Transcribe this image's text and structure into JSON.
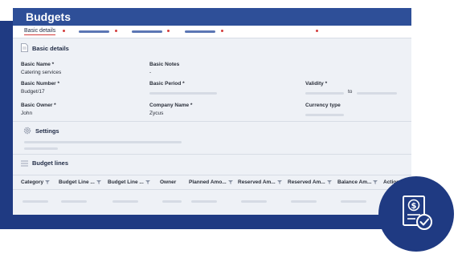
{
  "window": {
    "title": "Budgets"
  },
  "tabs": {
    "active_label": "Basic details"
  },
  "basic_details": {
    "section_title": "Basic details",
    "basic_name_label": "Basic Name *",
    "basic_name_value": "Catering services",
    "basic_notes_label": "Basic Notes",
    "basic_notes_value": "-",
    "basic_number_label": "Basic Number *",
    "basic_number_value": "Budget/17",
    "basic_period_label": "Basic Period *",
    "validity_label": "Validity *",
    "validity_to": "to",
    "basic_owner_label": "Basic Owner *",
    "basic_owner_value": "John",
    "company_name_label": "Company Name *",
    "company_name_value": "Zycus",
    "currency_type_label": "Currency type"
  },
  "settings": {
    "section_title": "Settings"
  },
  "budget_lines": {
    "section_title": "Budget lines",
    "columns": [
      "Category",
      "Budget Line ...",
      "Budget Line ...",
      "Owner",
      "Planned Amo...",
      "Reserved Am...",
      "Reserved Am...",
      "Balance Am...",
      "Action"
    ]
  },
  "colors": {
    "header": "#2e4f98",
    "frame": "#1f3a82",
    "accent": "#d33c3c",
    "panel": "#eef1f6"
  },
  "icons": {
    "section_basic": "document-icon",
    "section_settings": "gear-icon",
    "section_budget_lines": "list-icon",
    "column_filter": "filter-icon",
    "badge": "invoice-dollar-check-icon"
  }
}
